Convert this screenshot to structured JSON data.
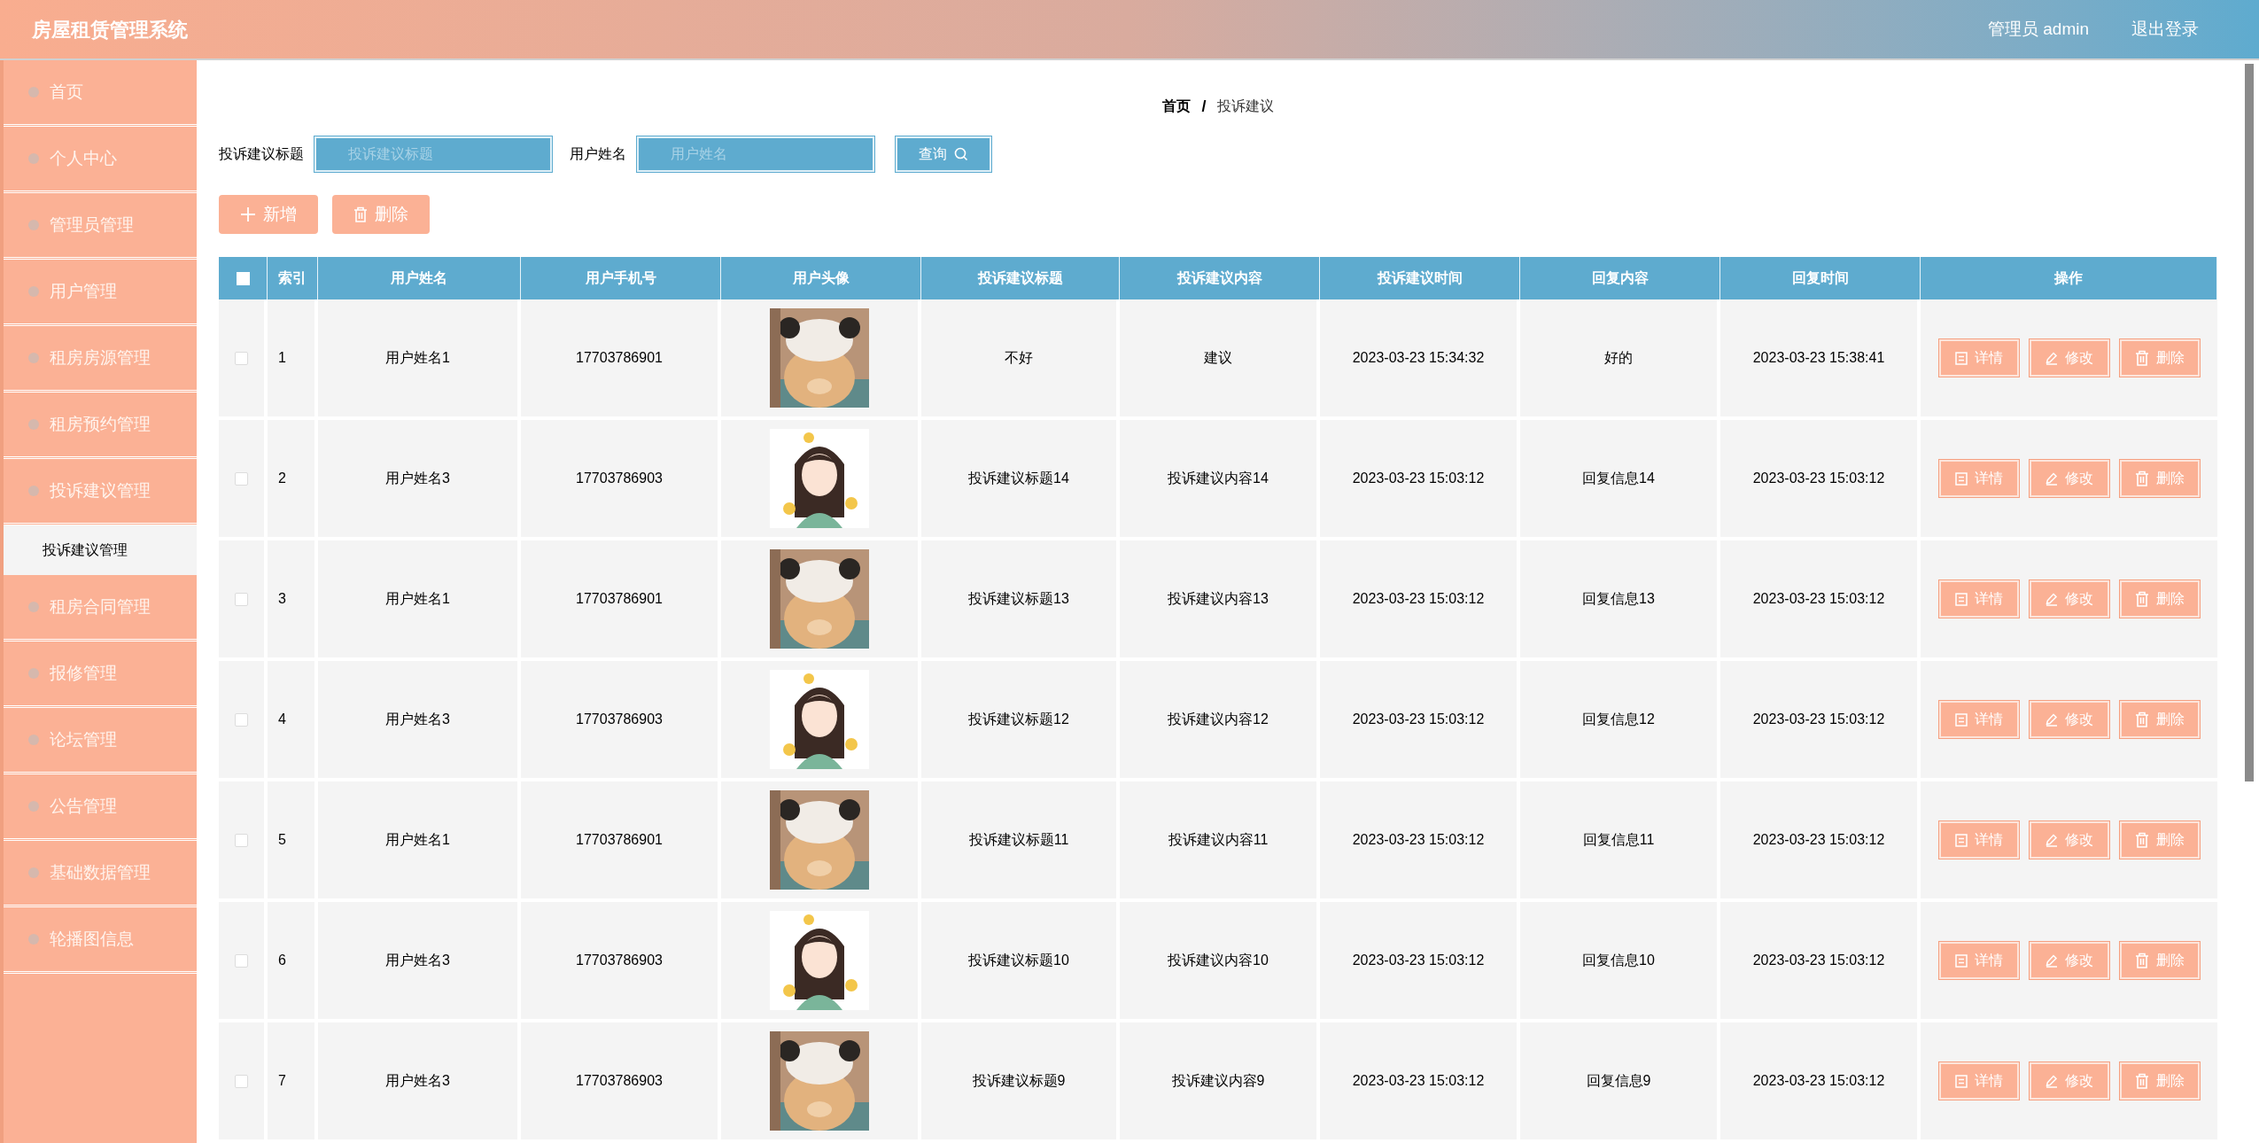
{
  "header": {
    "title": "房屋租赁管理系统",
    "user": "管理员 admin",
    "logout": "退出登录"
  },
  "sidebar": {
    "items": [
      {
        "label": "首页"
      },
      {
        "label": "个人中心"
      },
      {
        "label": "管理员管理"
      },
      {
        "label": "用户管理"
      },
      {
        "label": "租房房源管理"
      },
      {
        "label": "租房预约管理"
      },
      {
        "label": "投诉建议管理",
        "children": [
          {
            "label": "投诉建议管理",
            "selected": true
          }
        ]
      },
      {
        "label": "租房合同管理"
      },
      {
        "label": "报修管理"
      },
      {
        "label": "论坛管理"
      },
      {
        "label": "公告管理"
      },
      {
        "label": "基础数据管理"
      },
      {
        "label": "轮播图信息"
      }
    ]
  },
  "breadcrumb": {
    "items": [
      "首页",
      "投诉建议"
    ],
    "separator": "/"
  },
  "search": {
    "fields": [
      {
        "label": "投诉建议标题",
        "placeholder": "投诉建议标题"
      },
      {
        "label": "用户姓名",
        "placeholder": "用户姓名"
      }
    ],
    "button": "查询"
  },
  "toolbar": [
    {
      "kind": "add",
      "label": "新增"
    },
    {
      "kind": "delete",
      "label": "删除"
    }
  ],
  "table": {
    "select_all_checked": false,
    "columns": [
      "索引",
      "用户姓名",
      "用户手机号",
      "用户头像",
      "投诉建议标题",
      "投诉建议内容",
      "投诉建议时间",
      "回复内容",
      "回复时间",
      "操作"
    ],
    "rows": [
      {
        "checked": false,
        "index": "1",
        "name": "用户姓名1",
        "phone": "17703786901",
        "title": "不好",
        "content": "建议",
        "time": "2023-03-23 15:34:32",
        "reply": "好的",
        "reply_time": "2023-03-23 15:38:41",
        "actions": [
          {
            "kind": "detail",
            "label": "详情"
          },
          {
            "kind": "edit",
            "label": "修改"
          },
          {
            "kind": "delete",
            "label": "删除"
          }
        ]
      },
      {
        "checked": false,
        "index": "2",
        "name": "用户姓名3",
        "phone": "17703786903",
        "title": "投诉建议标题14",
        "content": "投诉建议内容14",
        "time": "2023-03-23 15:03:12",
        "reply": "回复信息14",
        "reply_time": "2023-03-23 15:03:12",
        "actions": [
          {
            "kind": "detail",
            "label": "详情"
          },
          {
            "kind": "edit",
            "label": "修改"
          },
          {
            "kind": "delete",
            "label": "删除"
          }
        ]
      },
      {
        "checked": false,
        "index": "3",
        "name": "用户姓名1",
        "phone": "17703786901",
        "title": "投诉建议标题13",
        "content": "投诉建议内容13",
        "time": "2023-03-23 15:03:12",
        "reply": "回复信息13",
        "reply_time": "2023-03-23 15:03:12",
        "actions": [
          {
            "kind": "detail",
            "label": "详情"
          },
          {
            "kind": "edit",
            "label": "修改"
          },
          {
            "kind": "delete",
            "label": "删除"
          }
        ]
      },
      {
        "checked": false,
        "index": "4",
        "name": "用户姓名3",
        "phone": "17703786903",
        "title": "投诉建议标题12",
        "content": "投诉建议内容12",
        "time": "2023-03-23 15:03:12",
        "reply": "回复信息12",
        "reply_time": "2023-03-23 15:03:12",
        "actions": [
          {
            "kind": "detail",
            "label": "详情"
          },
          {
            "kind": "edit",
            "label": "修改"
          },
          {
            "kind": "delete",
            "label": "删除"
          }
        ]
      },
      {
        "checked": false,
        "index": "5",
        "name": "用户姓名1",
        "phone": "17703786901",
        "title": "投诉建议标题11",
        "content": "投诉建议内容11",
        "time": "2023-03-23 15:03:12",
        "reply": "回复信息11",
        "reply_time": "2023-03-23 15:03:12",
        "actions": [
          {
            "kind": "detail",
            "label": "详情"
          },
          {
            "kind": "edit",
            "label": "修改"
          },
          {
            "kind": "delete",
            "label": "删除"
          }
        ]
      },
      {
        "checked": false,
        "index": "6",
        "name": "用户姓名3",
        "phone": "17703786903",
        "title": "投诉建议标题10",
        "content": "投诉建议内容10",
        "time": "2023-03-23 15:03:12",
        "reply": "回复信息10",
        "reply_time": "2023-03-23 15:03:12",
        "actions": [
          {
            "kind": "detail",
            "label": "详情"
          },
          {
            "kind": "edit",
            "label": "修改"
          },
          {
            "kind": "delete",
            "label": "删除"
          }
        ]
      },
      {
        "checked": false,
        "index": "7",
        "name": "用户姓名3",
        "phone": "17703786903",
        "title": "投诉建议标题9",
        "content": "投诉建议内容9",
        "time": "2023-03-23 15:03:12",
        "reply": "回复信息9",
        "reply_time": "2023-03-23 15:03:12",
        "actions": [
          {
            "kind": "detail",
            "label": "详情"
          },
          {
            "kind": "edit",
            "label": "修改"
          },
          {
            "kind": "delete",
            "label": "删除"
          }
        ]
      }
    ]
  }
}
